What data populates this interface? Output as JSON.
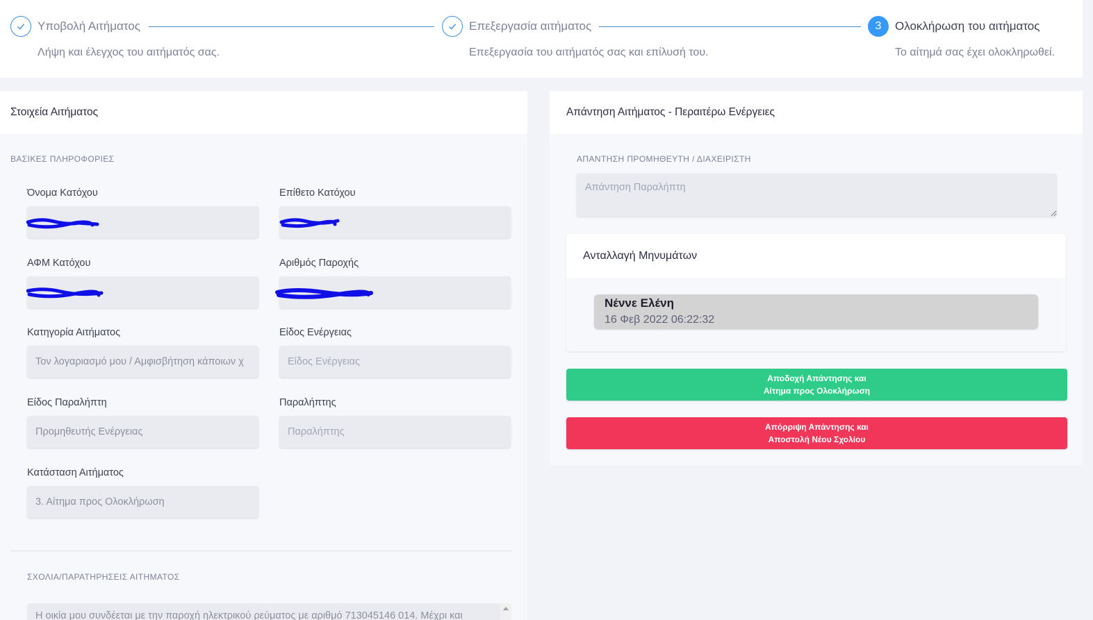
{
  "stepper": {
    "steps": [
      {
        "number": "",
        "title": "Υποβολή Αιτήματος",
        "description": "Λήψη και έλεγχος του αιτήματός σας.",
        "state": "done"
      },
      {
        "number": "",
        "title": "Επεξεργασία αιτήματος",
        "description": "Επεξεργασία του αιτήματός σας και επίλυσή του.",
        "state": "done"
      },
      {
        "number": "3",
        "title": "Ολοκλήρωση του αιτήματος",
        "description": "Το αίτημά σας έχει ολοκληρωθεί.",
        "state": "active"
      }
    ]
  },
  "request_details": {
    "header": "Στοιχεία Αιτήματος",
    "section_basic": "ΒΑΣΙΚΕΣ ΠΛΗΡΟΦΟΡΙΕΣ",
    "fields": {
      "owner_first_name": {
        "label": "Όνομα Κατόχου",
        "value": ""
      },
      "owner_last_name": {
        "label": "Επίθετο Κατόχου",
        "value": ""
      },
      "owner_tax_id": {
        "label": "ΑΦΜ Κατόχου",
        "value": ""
      },
      "supply_number": {
        "label": "Αριθμός Παροχής",
        "value": ""
      },
      "request_category": {
        "label": "Κατηγορία Αιτήματος",
        "value": "Τον λογαριασμό μου / Αμφισβήτηση κάποιων χ"
      },
      "energy_type": {
        "label": "Είδος Ενέργειας",
        "placeholder": "Είδος Ενέργειας"
      },
      "recipient_type": {
        "label": "Είδος Παραλήπτη",
        "value": "Προμηθευτής Ενέργειας"
      },
      "recipient": {
        "label": "Παραλήπτης",
        "placeholder": "Παραλήπτης"
      },
      "request_status": {
        "label": "Κατάσταση Αιτήματος",
        "value": "3. Αίτημα προς Ολοκλήρωση"
      }
    },
    "section_comments": "ΣΧΟΛΙΑ/ΠΑΡΑΤΗΡΗΣΕΙΣ ΑΙΤΗΜΑΤΟΣ",
    "comments_text": "Η οικία μου συνδέεται με την παροχή ηλεκτρικού ρεύματος με αριθμό 713045146 014. Μέχρι και"
  },
  "response": {
    "header": "Απάντηση Αιτήματος - Περαιτέρω Ενέργειες",
    "section_label": "ΑΠΑΝΤΗΣΗ ΠΡΟΜΗΘΕΥΤΗ / ΔΙΑΧΕΙΡΙΣΤΗ",
    "reply_placeholder": "Απάντηση Παραλήπτη",
    "messages": {
      "header": "Ανταλλαγή Μηνυμάτων",
      "items": [
        {
          "name": "Νέννε Ελένη",
          "date": "16 Φεβ 2022 06:22:32"
        }
      ]
    },
    "accept_button": {
      "line1": "Αποδοχή Απάντησης και",
      "line2": "Αίτημα προς Ολοκλήρωση"
    },
    "reject_button": {
      "line1": "Απόρριψη Απάντησης και",
      "line2": "Αποστολή Νέου Σχολίου"
    }
  },
  "colors": {
    "accent": "#3699ff",
    "accept": "#2ecc88",
    "reject": "#f1365a"
  }
}
